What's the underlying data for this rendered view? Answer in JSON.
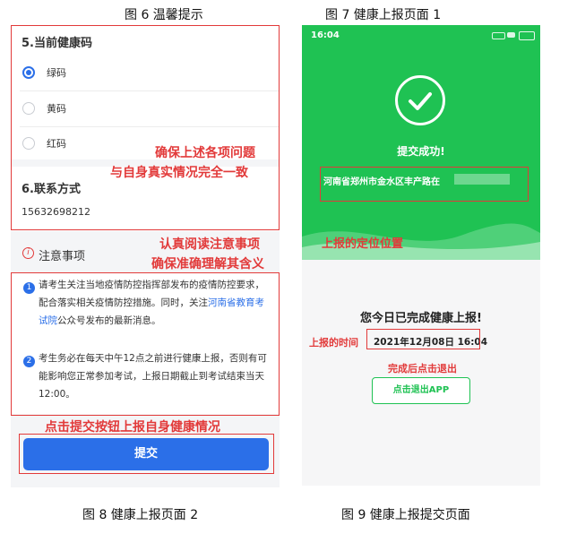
{
  "captions": {
    "fig6": "图 6 温馨提示",
    "fig7": "图 7 健康上报页面 1",
    "fig8": "图 8 健康上报页面 2",
    "fig9": "图 9 健康上报提交页面"
  },
  "left": {
    "section5_title": "5.当前健康码",
    "options": [
      "绿码",
      "黄码",
      "红码"
    ],
    "selected_option": "绿码",
    "section6_title": "6.联系方式",
    "phone_value": "15632698212",
    "annotation_1_line1": "确保上述各项问题",
    "annotation_1_line2": "与自身真实情况完全一致",
    "notice_title": "注意事项",
    "annotation_2_line1": "认真阅读注意事项",
    "annotation_2_line2": "确保准确理解其含义",
    "notice_1_part1": "请考生关注当地疫情防控指挥部发布的疫情防控要求，配合落实相关疫情防控措施。同时，关注",
    "notice_1_link": "河南省教育考试院",
    "notice_1_part2": "公众号发布的最新消息。",
    "notice_2": "考生务必在每天中午12点之前进行健康上报，否则有可能影响您正常参加考试，上报日期截止到考试结束当天12:00。",
    "annotation_3": "点击提交按钮上报自身健康情况",
    "submit_label": "提交"
  },
  "right": {
    "status_time": "16:04",
    "success_text": "提交成功!",
    "location_text": "河南省郑州市金水区丰产路在",
    "annotation_location": "上报的定位位置",
    "done_message": "您今日已完成健康上报!",
    "annotation_time": "上报的时间",
    "report_time": "2021年12月08日 16:04",
    "annotation_exit": "完成后点击退出",
    "exit_button": "点击退出APP"
  },
  "colors": {
    "accent_blue": "#2b6fe8",
    "success_green": "#1fc253",
    "annotation_red": "#e23a3a"
  }
}
